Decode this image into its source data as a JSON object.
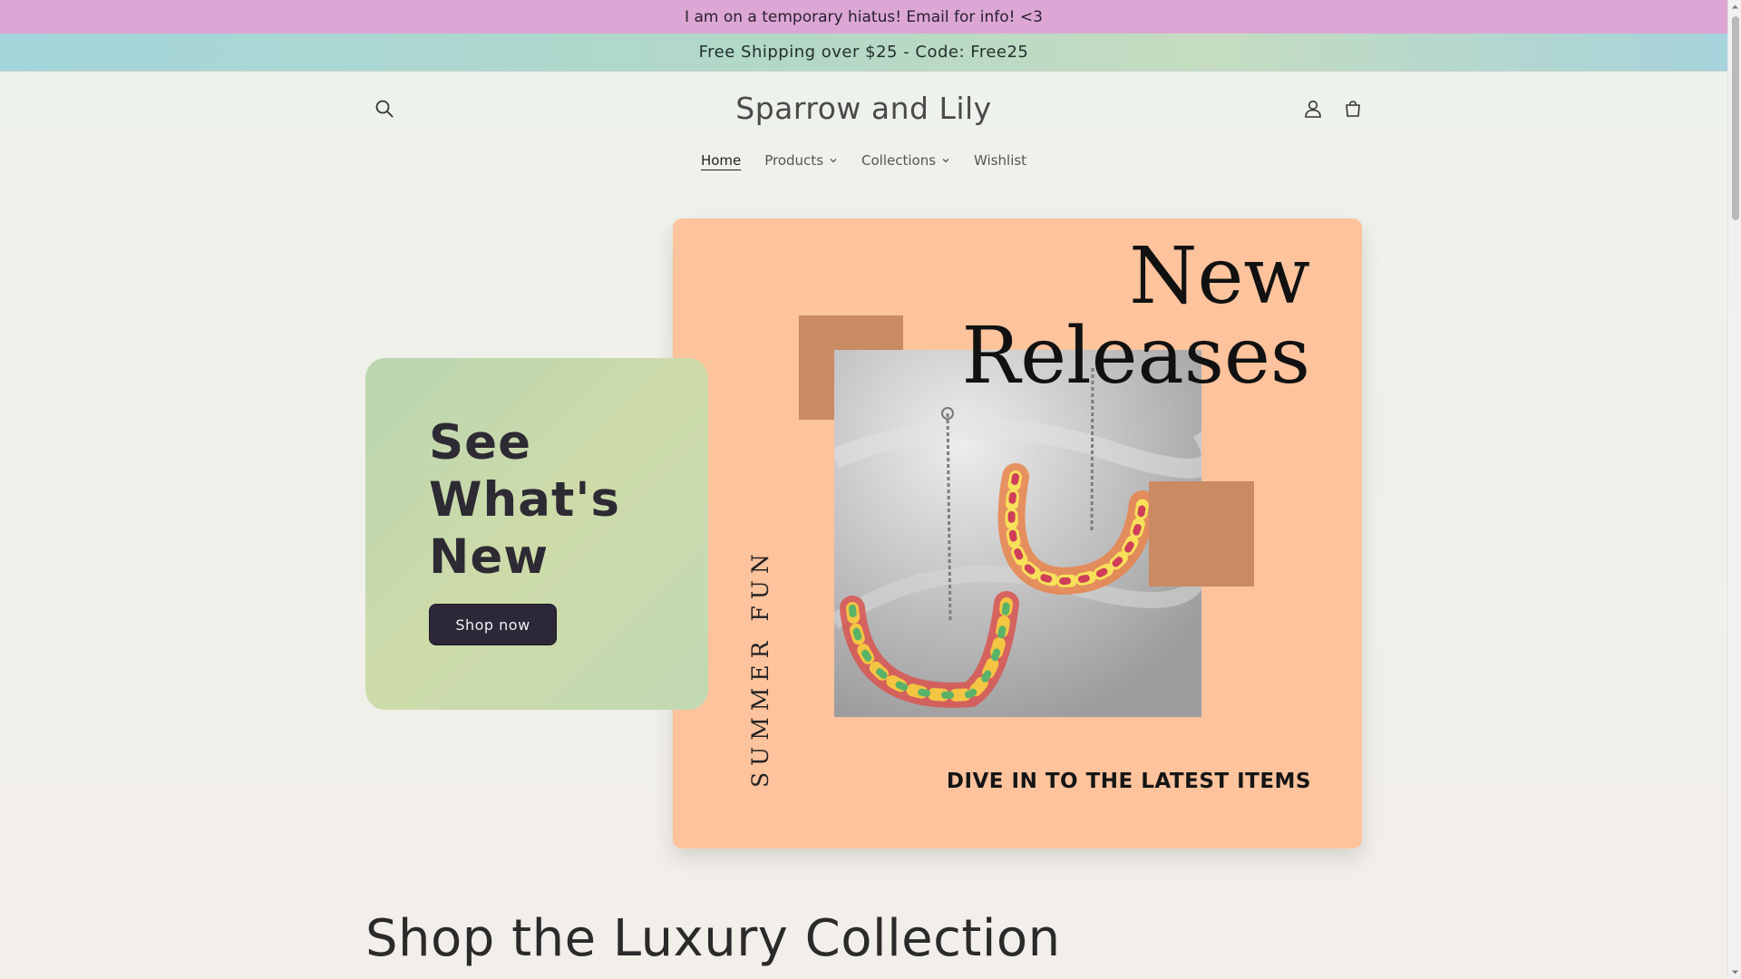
{
  "announcements": {
    "top": "I am on a temporary hiatus! Email for info! <3",
    "shipping": "Free Shipping over $25 - Code: Free25"
  },
  "header": {
    "logo": "Sparrow and Lily",
    "icons": [
      "search-icon",
      "account-icon",
      "cart-icon"
    ]
  },
  "nav": {
    "items": [
      {
        "label": "Home",
        "active": true
      },
      {
        "label": "Products",
        "dropdown": true
      },
      {
        "label": "Collections",
        "dropdown": true
      },
      {
        "label": "Wishlist"
      }
    ]
  },
  "hero": {
    "heading": "See What's New",
    "button": "Shop now"
  },
  "promo": {
    "title_line1": "New",
    "title_line2": "Releases",
    "vertical_text": "SUMMER FUN",
    "subtitle": "DIVE IN TO THE LATEST ITEMS",
    "bg_color": "#fdc39d",
    "square_color": "#c98a64"
  },
  "section": {
    "title": "Shop the Luxury Collection"
  },
  "colors": {
    "announcement_top": "#dca7d4",
    "hero_card": "#c7d9b0",
    "button_dark": "#2d2838"
  }
}
